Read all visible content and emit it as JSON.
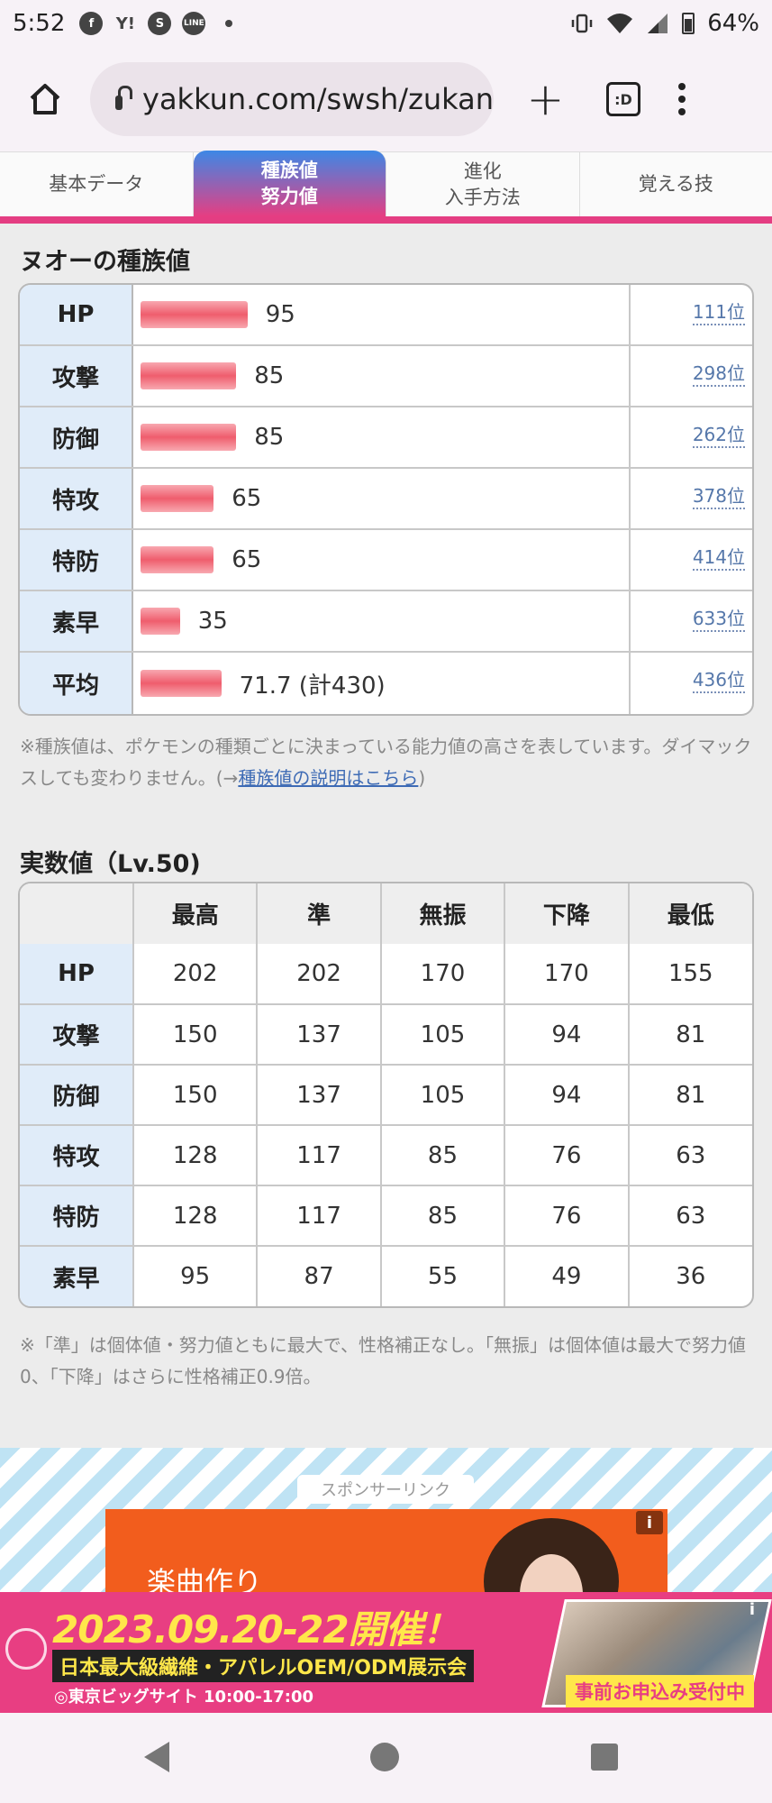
{
  "status_bar": {
    "time": "5:52",
    "battery": "64%",
    "left_icons": [
      "facebook-icon",
      "yahoo-icon",
      "smartnews-icon",
      "line-icon"
    ]
  },
  "browser": {
    "url": "yakkun.com/swsh/zukan",
    "tab_count": ":D"
  },
  "nav_tabs": [
    {
      "line1": "基本データ",
      "line2": ""
    },
    {
      "line1": "種族値",
      "line2": "努力値"
    },
    {
      "line1": "進化",
      "line2": "入手方法"
    },
    {
      "line1": "覚える技",
      "line2": ""
    }
  ],
  "base_stats": {
    "heading": "ヌオーの種族値",
    "rows": [
      {
        "label": "HP",
        "value": "95",
        "rank": "111位",
        "bar": 95
      },
      {
        "label": "攻撃",
        "value": "85",
        "rank": "298位",
        "bar": 85
      },
      {
        "label": "防御",
        "value": "85",
        "rank": "262位",
        "bar": 85
      },
      {
        "label": "特攻",
        "value": "65",
        "rank": "378位",
        "bar": 65
      },
      {
        "label": "特防",
        "value": "65",
        "rank": "414位",
        "bar": 65
      },
      {
        "label": "素早",
        "value": "35",
        "rank": "633位",
        "bar": 35
      },
      {
        "label": "平均",
        "value": "71.7  (計430)",
        "rank": "436位",
        "bar": 71.7
      }
    ],
    "note_text": "※種族値は、ポケモンの種類ごとに決まっている能力値の高さを表しています。ダイマックスしても変わりません。(→",
    "note_link": "種族値の説明はこちら",
    "note_end": ")"
  },
  "real_stats": {
    "heading": "実数値（Lv.50)",
    "columns": [
      "最高",
      "準",
      "無振",
      "下降",
      "最低"
    ],
    "rows": [
      {
        "label": "HP",
        "values": [
          "202",
          "202",
          "170",
          "170",
          "155"
        ]
      },
      {
        "label": "攻撃",
        "values": [
          "150",
          "137",
          "105",
          "94",
          "81"
        ]
      },
      {
        "label": "防御",
        "values": [
          "150",
          "137",
          "105",
          "94",
          "81"
        ]
      },
      {
        "label": "特攻",
        "values": [
          "128",
          "117",
          "85",
          "76",
          "63"
        ]
      },
      {
        "label": "特防",
        "values": [
          "128",
          "117",
          "85",
          "76",
          "63"
        ]
      },
      {
        "label": "素早",
        "values": [
          "95",
          "87",
          "55",
          "49",
          "36"
        ]
      }
    ],
    "note": "※「準」は個体値・努力値ともに最大で、性格補正なし。「無振」は個体値は最大で努力値0、「下降」はさらに性格補正0.9倍。"
  },
  "ads": {
    "sponsor_label": "スポンサーリンク",
    "ad1_text": "楽曲作り",
    "banner_date": "2023.09.20-22開催！",
    "banner_sub": "日本最大級繊維・アパレルOEM/ODM展示会",
    "banner_place": "◎東京ビッグサイト 10:00-17:00",
    "banner_cta": "事前お申込み受付中",
    "info": "i"
  }
}
